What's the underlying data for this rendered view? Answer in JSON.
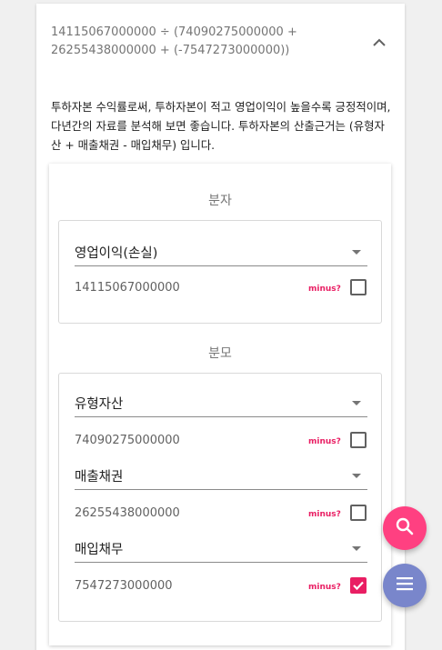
{
  "header": {
    "formula": "14115067000000 ÷ (74090275000000 + 26255438000000 + (-7547273000000))",
    "collapse_icon": "chevron-up-icon"
  },
  "description": "투하자본 수익률로써, 투하자본이 적고 영업이익이 높을수록 긍정적이며, 다년간의 자료를 분석해 보면 좋습니다. 투하자본의 산출근거는 (유형자산 + 매출채권 - 매입채무) 입니다.",
  "numerator": {
    "title": "분자",
    "items": [
      {
        "select_label": "영업이익(손실)",
        "value": "14115067000000",
        "minus_label": "minus?",
        "minus_checked": false
      }
    ]
  },
  "denominator": {
    "title": "분모",
    "items": [
      {
        "select_label": "유형자산",
        "value": "74090275000000",
        "minus_label": "minus?",
        "minus_checked": false
      },
      {
        "select_label": "매출채권",
        "value": "26255438000000",
        "minus_label": "minus?",
        "minus_checked": false
      },
      {
        "select_label": "매입채무",
        "value": "7547273000000",
        "minus_label": "minus?",
        "minus_checked": true
      }
    ]
  },
  "fabs": {
    "search_icon": "search-icon",
    "menu_icon": "menu-icon",
    "search_color": "#ff4081",
    "menu_color": "#7986cb"
  },
  "colors": {
    "accent": "#e91e63"
  }
}
